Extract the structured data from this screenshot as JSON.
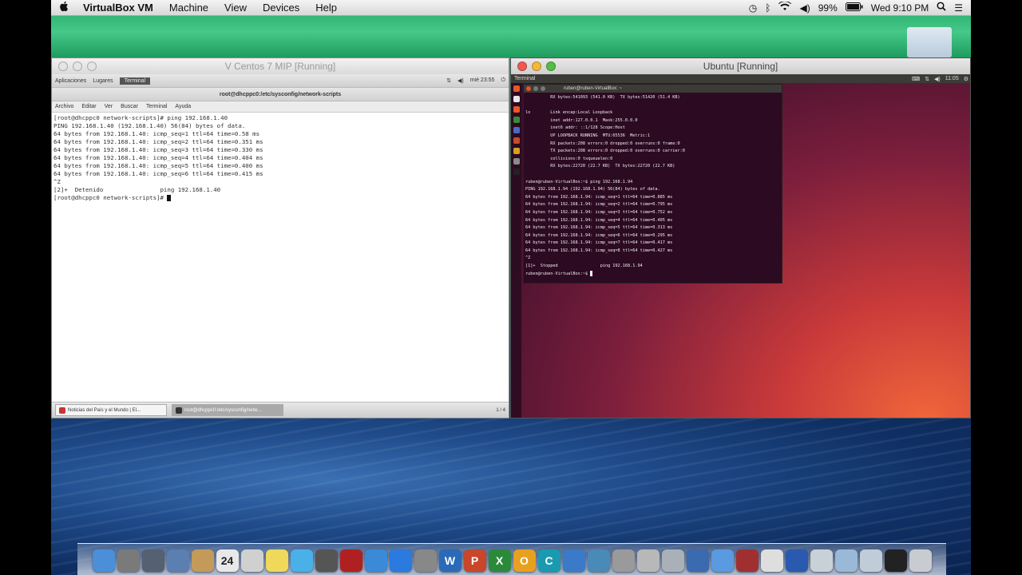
{
  "menubar": {
    "apple": "",
    "app": "VirtualBox VM",
    "items": [
      "Machine",
      "View",
      "Devices",
      "Help"
    ],
    "battery": "99%",
    "clock": "Wed 9:10 PM"
  },
  "left_window": {
    "title": "V Centos 7 MIP [Running]",
    "panel": {
      "apps": "Aplicaciones",
      "places": "Lugares",
      "active": "Terminal",
      "clock": "mié 23:55"
    },
    "terminal_title": "root@dhcppc0:/etc/sysconfig/network-scripts",
    "menu": [
      "Archivo",
      "Editar",
      "Ver",
      "Buscar",
      "Terminal",
      "Ayuda"
    ],
    "lines": [
      "[root@dhcppc0 network-scripts]# ping 192.168.1.40",
      "PING 192.168.1.40 (192.168.1.40) 56(84) bytes of data.",
      "64 bytes from 192.168.1.40: icmp_seq=1 ttl=64 time=0.58 ms",
      "64 bytes from 192.168.1.40: icmp_seq=2 ttl=64 time=0.351 ms",
      "64 bytes from 192.168.1.40: icmp_seq=3 ttl=64 time=0.330 ms",
      "64 bytes from 192.168.1.40: icmp_seq=4 ttl=64 time=0.404 ms",
      "64 bytes from 192.168.1.40: icmp_seq=5 ttl=64 time=0.400 ms",
      "64 bytes from 192.168.1.40: icmp_seq=6 ttl=64 time=0.415 ms",
      "^Z",
      "[2]+  Detenido                ping 192.168.1.40",
      "[root@dhcppc0 network-scripts]# "
    ],
    "taskbar": {
      "item1": "Noticias del País y el Mundo | El...",
      "item2": "root@dhcppc0:/etc/sysconfig/netw...",
      "pager": "1 / 4"
    }
  },
  "right_window": {
    "title": "Ubuntu [Running]",
    "panel_title": "Terminal",
    "panel_right": "11:05",
    "terminal_title": "ruben@ruben-VirtualBox: ~",
    "lines": [
      "          RX bytes:541093 (541.0 KB)  TX bytes:51420 (51.4 KB)",
      "",
      "lo        Link encap:Local Loopback",
      "          inet addr:127.0.0.1  Mask:255.0.0.0",
      "          inet6 addr: ::1/128 Scope:Host",
      "          UP LOOPBACK RUNNING  MTU:65536  Metric:1",
      "          RX packets:208 errors:0 dropped:0 overruns:0 frame:0",
      "          TX packets:208 errors:0 dropped:0 overruns:0 carrier:0",
      "          collisions:0 txqueuelen:0",
      "          RX bytes:22720 (22.7 KB)  TX bytes:22720 (22.7 KB)",
      "",
      "ruben@ruben-VirtualBox:~$ ping 192.168.1.94",
      "PING 192.168.1.94 (192.168.1.94) 56(84) bytes of data.",
      "64 bytes from 192.168.1.94: icmp_seq=1 ttl=64 time=0.885 ms",
      "64 bytes from 192.168.1.94: icmp_seq=2 ttl=64 time=0.795 ms",
      "64 bytes from 192.168.1.94: icmp_seq=3 ttl=64 time=0.752 ms",
      "64 bytes from 192.168.1.94: icmp_seq=4 ttl=64 time=0.405 ms",
      "64 bytes from 192.168.1.94: icmp_seq=5 ttl=64 time=0.313 ms",
      "64 bytes from 192.168.1.94: icmp_seq=6 ttl=64 time=0.295 ms",
      "64 bytes from 192.168.1.94: icmp_seq=7 ttl=64 time=0.417 ms",
      "64 bytes from 192.168.1.94: icmp_seq=8 ttl=64 time=0.427 ms",
      "^Z",
      "[1]+  Stopped                 ping 192.168.1.94",
      "ruben@ruben-VirtualBox:~$ "
    ]
  },
  "dock": [
    {
      "name": "finder-icon",
      "color": "#4a8fd8",
      "glyph": ""
    },
    {
      "name": "launchpad-icon",
      "color": "#7a7a7a",
      "glyph": ""
    },
    {
      "name": "mission-control-icon",
      "color": "#556070",
      "glyph": ""
    },
    {
      "name": "preview-icon",
      "color": "#5b7fb0",
      "glyph": ""
    },
    {
      "name": "contacts-icon",
      "color": "#c49a5a",
      "glyph": ""
    },
    {
      "name": "calendar-icon",
      "color": "#e8e8e8",
      "glyph": "24"
    },
    {
      "name": "textedit-icon",
      "color": "#d0d0d0",
      "glyph": ""
    },
    {
      "name": "stickies-icon",
      "color": "#f0d85a",
      "glyph": ""
    },
    {
      "name": "messages-icon",
      "color": "#4ab0e8",
      "glyph": ""
    },
    {
      "name": "facetime-icon",
      "color": "#555",
      "glyph": ""
    },
    {
      "name": "photo-booth-icon",
      "color": "#b02020",
      "glyph": ""
    },
    {
      "name": "itunes-icon",
      "color": "#3a8ad8",
      "glyph": ""
    },
    {
      "name": "app-store-icon",
      "color": "#2a7ae0",
      "glyph": ""
    },
    {
      "name": "system-preferences-icon",
      "color": "#888",
      "glyph": ""
    },
    {
      "name": "word-icon",
      "color": "#2a6ab8",
      "glyph": "W"
    },
    {
      "name": "powerpoint-icon",
      "color": "#c8462a",
      "glyph": "P"
    },
    {
      "name": "excel-icon",
      "color": "#2a8a3a",
      "glyph": "X"
    },
    {
      "name": "outlook-icon",
      "color": "#e8a020",
      "glyph": "O"
    },
    {
      "name": "communicator-icon",
      "color": "#1a9ab0",
      "glyph": "C"
    },
    {
      "name": "remote-desktop-icon",
      "color": "#3a7ac8",
      "glyph": ""
    },
    {
      "name": "network-icon",
      "color": "#4a8ab8",
      "glyph": ""
    },
    {
      "name": "utilities-icon",
      "color": "#9a9a9a",
      "glyph": ""
    },
    {
      "name": "printer-icon",
      "color": "#b8b8b8",
      "glyph": ""
    },
    {
      "name": "disk-utility-icon",
      "color": "#aab0b8",
      "glyph": ""
    },
    {
      "name": "virtualbox-icon",
      "color": "#3a6ab0",
      "glyph": ""
    },
    {
      "name": "safari-icon",
      "color": "#5a9ae0",
      "glyph": ""
    },
    {
      "name": "photo-icon",
      "color": "#a03030",
      "glyph": ""
    },
    {
      "name": "preview-window-icon",
      "color": "#dedede",
      "glyph": ""
    },
    {
      "name": "quicktime-icon",
      "color": "#2a5ab0",
      "glyph": ""
    },
    {
      "name": "documents-icon",
      "color": "#c8d0d8",
      "glyph": ""
    },
    {
      "name": "folder-icon",
      "color": "#9ab8d8",
      "glyph": ""
    },
    {
      "name": "downloads-icon",
      "color": "#c0ccd8",
      "glyph": ""
    },
    {
      "name": "terminal-icon",
      "color": "#222",
      "glyph": ""
    },
    {
      "name": "trash-icon",
      "color": "#c8ccd0",
      "glyph": ""
    }
  ]
}
